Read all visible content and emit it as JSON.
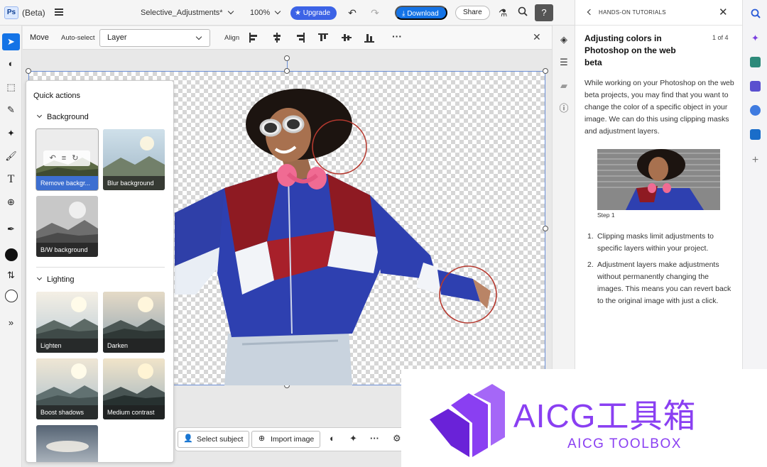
{
  "topbar": {
    "app_logo": "Ps",
    "beta": "(Beta)",
    "doc_name": "Selective_Adjustments*",
    "zoom": "100%",
    "upgrade": "Upgrade",
    "download": "Download",
    "share": "Share"
  },
  "options": {
    "move": "Move",
    "auto_select": "Auto-select",
    "layer_value": "Layer",
    "align": "Align"
  },
  "quick_actions": {
    "title": "Quick actions",
    "sections": [
      {
        "label": "Background",
        "items": [
          "Remove backgr...",
          "Blur background",
          "B/W background"
        ]
      },
      {
        "label": "Lighting",
        "items": [
          "Lighten",
          "Darken",
          "Boost shadows",
          "Medium contrast"
        ]
      }
    ]
  },
  "bottom_bar": {
    "select_subject": "Select subject",
    "import_image": "Import image"
  },
  "tutorial": {
    "header": "HANDS-ON TUTORIALS",
    "title": "Adjusting colors in Photoshop on the web beta",
    "count": "1 of 4",
    "intro": "While working on your Photoshop on the web beta projects, you may find that you want to change the color of a specific object in your image. We can do this using clipping masks and adjustment layers.",
    "step_caption": "Step 1",
    "list": [
      "Clipping masks limit adjustments to specific layers within your project.",
      "Adjustment layers make adjustments without permanently changing the images. This means you can revert back to the original image with just a click."
    ]
  },
  "watermark": {
    "title": "AICG工具箱",
    "subtitle": "AICG TOOLBOX"
  },
  "colors": {
    "accent": "#1473e6",
    "upgrade": "#3c63e6",
    "watermark": "#8a3ff2"
  }
}
